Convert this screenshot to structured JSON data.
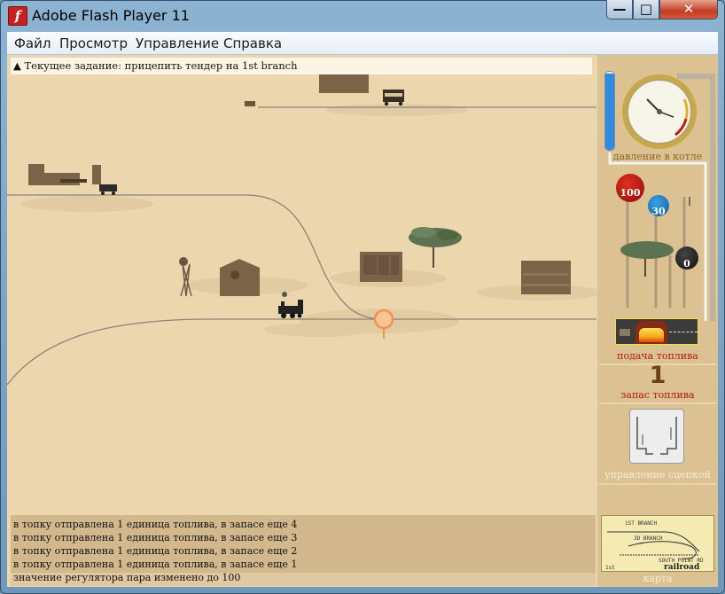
{
  "window": {
    "title": "Adobe Flash Player 11",
    "logo_glyph": "f",
    "minimize_glyph": "—",
    "maximize_glyph": "□",
    "close_glyph": "✕"
  },
  "menu": {
    "items": [
      "Файл",
      "Просмотр",
      "Управление",
      "Справка"
    ]
  },
  "task": {
    "icon_glyph": "▲",
    "text": "Текущее задание: прицепить тендер на 1st branch"
  },
  "controls": {
    "gauge_label": "давление в котле",
    "regulator_value": "100",
    "knob_blue_value": "30",
    "knob_black_value": "0",
    "fuel_feed_label": "подача топлива",
    "fuel_stock_value": "1",
    "fuel_stock_label": "запас топлива",
    "coupling_label": "управление сцепкой",
    "map_label": "карта"
  },
  "map_thumbnail": {
    "texts": [
      "1ST BRANCH",
      "3D BRANCH",
      "SOUTH POINT RD",
      "railroad",
      "1st"
    ]
  },
  "log": {
    "lines": [
      "в топку отправлена 1 единица топлива, в запасе еще 4",
      "в топку отправлена 1 единица топлива, в запасе еще 3",
      "в топку отправлена 1 единица топлива, в запасе еще 2",
      "в топку отправлена 1 единица топлива, в запасе еще 1",
      "значение регулятора пара изменено до 100"
    ]
  },
  "colors": {
    "ground": "#ecd6ad",
    "track": "#8a8478",
    "building": "#7b6347",
    "tree": "#5d7250",
    "pressure_bar": "#2f8ae0",
    "marker": "#f39254",
    "fire": "#f6a91a"
  },
  "icons": [
    "flash-logo-icon",
    "warning-triangle-icon",
    "steam-pressure-gauge-icon",
    "regulator-knob-icon",
    "firebox-icon",
    "coupling-icon",
    "map-icon",
    "locomotive-icon",
    "railcar-icon"
  ]
}
